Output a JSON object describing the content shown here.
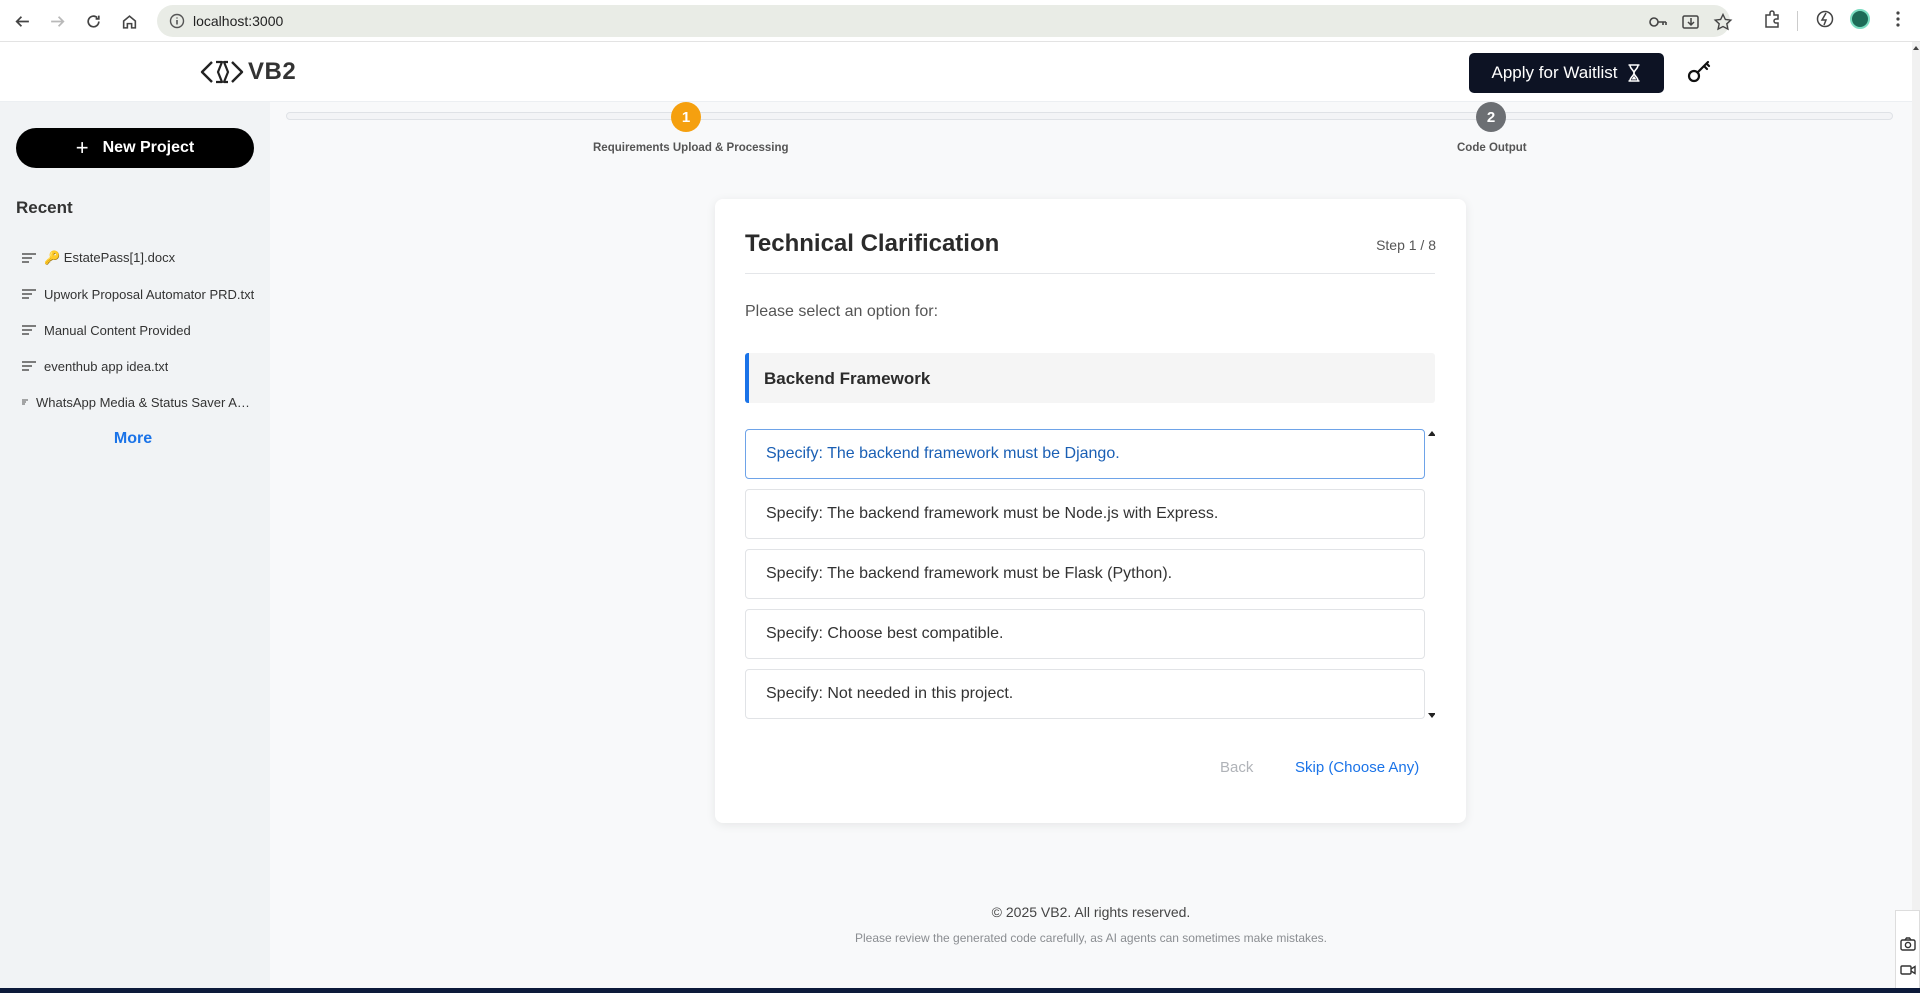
{
  "browser": {
    "url": "localhost:3000"
  },
  "app": {
    "logo_text": "VB2",
    "waitlist_label": "Apply for Waitlist"
  },
  "sidebar": {
    "new_project_label": "New Project",
    "recent_title": "Recent",
    "items": [
      {
        "label": "🔑 EstatePass[1].docx"
      },
      {
        "label": "Upwork Proposal Automator PRD.txt"
      },
      {
        "label": "Manual Content Provided"
      },
      {
        "label": "eventhub app idea.txt"
      },
      {
        "label": "WhatsApp Media & Status Saver App"
      }
    ],
    "more_label": "More"
  },
  "stepper": {
    "steps": [
      {
        "number": "1",
        "label": "Requirements Upload & Processing",
        "status": "active"
      },
      {
        "number": "2",
        "label": "Code Output",
        "status": "inactive"
      }
    ],
    "active_color": "#f5a00f"
  },
  "card": {
    "title": "Technical Clarification",
    "step_indicator": "Step 1 / 8",
    "prompt": "Please select an option for:",
    "topic": "Backend Framework",
    "options": [
      {
        "label": "Specify: The backend framework must be Django.",
        "selected": true
      },
      {
        "label": "Specify: The backend framework must be Node.js with Express.",
        "selected": false
      },
      {
        "label": "Specify: The backend framework must be Flask (Python).",
        "selected": false
      },
      {
        "label": "Specify: Choose best compatible.",
        "selected": false
      },
      {
        "label": "Specify: Not needed in this project.",
        "selected": false
      }
    ],
    "back_label": "Back",
    "skip_label": "Skip (Choose Any)"
  },
  "footer": {
    "copyright": "© 2025 VB2. All rights reserved.",
    "note": "Please review the generated code carefully, as AI agents can sometimes make mistakes."
  },
  "colors": {
    "accent": "#1a73e8",
    "dark_button": "#0d1324"
  }
}
